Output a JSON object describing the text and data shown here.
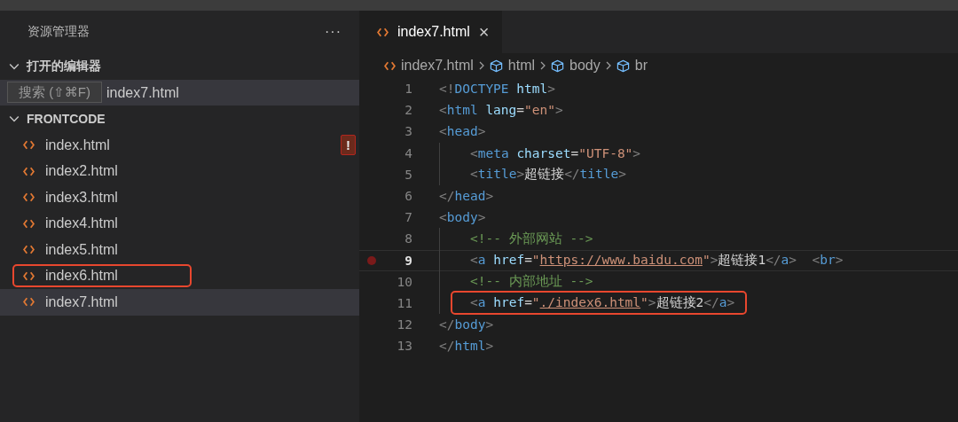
{
  "sidebar": {
    "title": "资源管理器",
    "more": "···",
    "open_editors": {
      "label": "打开的编辑器",
      "expanded": true,
      "items": [
        {
          "name": "index7.html"
        }
      ]
    },
    "tooltip": "搜索 (⇧⌘F)",
    "folder": {
      "label": "FRONTCODE",
      "expanded": true,
      "files": [
        {
          "name": "index.html",
          "selected": false,
          "highlighted": false,
          "badge": "!"
        },
        {
          "name": "index2.html",
          "selected": false,
          "highlighted": false
        },
        {
          "name": "index3.html",
          "selected": false,
          "highlighted": false
        },
        {
          "name": "index4.html",
          "selected": false,
          "highlighted": false
        },
        {
          "name": "index5.html",
          "selected": false,
          "highlighted": false
        },
        {
          "name": "index6.html",
          "selected": false,
          "highlighted": true
        },
        {
          "name": "index7.html",
          "selected": true,
          "highlighted": false
        }
      ]
    }
  },
  "tabs": [
    {
      "label": "index7.html",
      "selected": true,
      "close": "×"
    }
  ],
  "breadcrumb": [
    {
      "label": "index7.html",
      "kind": "file"
    },
    {
      "label": "html",
      "kind": "element"
    },
    {
      "label": "body",
      "kind": "element"
    },
    {
      "label": "br",
      "kind": "element"
    }
  ],
  "code": [
    {
      "number": "1",
      "tokens": [
        {
          "t": "<!",
          "kind": "punct"
        },
        {
          "t": "DOCTYPE",
          "kind": "tag"
        },
        {
          "t": " html",
          "kind": "attr"
        },
        {
          "t": ">",
          "kind": "punct"
        }
      ]
    },
    {
      "number": "2",
      "tokens": [
        {
          "t": "<",
          "kind": "punct"
        },
        {
          "t": "html",
          "kind": "tag"
        },
        {
          "t": " lang",
          "kind": "attr"
        },
        {
          "t": "=",
          "kind": "text"
        },
        {
          "t": "\"en\"",
          "kind": "str"
        },
        {
          "t": ">",
          "kind": "punct"
        }
      ]
    },
    {
      "number": "3",
      "tokens": [
        {
          "t": "<",
          "kind": "punct"
        },
        {
          "t": "head",
          "kind": "tag"
        },
        {
          "t": ">",
          "kind": "punct"
        }
      ],
      "children": [
        {
          "number": "4",
          "tokens": [
            {
              "t": "<",
              "kind": "punct"
            },
            {
              "t": "meta",
              "kind": "tag"
            },
            {
              "t": " charset",
              "kind": "attr"
            },
            {
              "t": "=",
              "kind": "text"
            },
            {
              "t": "\"UTF-8\"",
              "kind": "str"
            },
            {
              "t": ">",
              "kind": "punct"
            }
          ]
        },
        {
          "number": "5",
          "tokens": [
            {
              "t": "<",
              "kind": "punct"
            },
            {
              "t": "title",
              "kind": "tag"
            },
            {
              "t": ">",
              "kind": "punct"
            },
            {
              "t": "超链接",
              "kind": "text"
            },
            {
              "t": "</",
              "kind": "punct"
            },
            {
              "t": "title",
              "kind": "tag"
            },
            {
              "t": ">",
              "kind": "punct"
            }
          ]
        }
      ]
    },
    {
      "number": "6",
      "tokens": [
        {
          "t": "</",
          "kind": "punct"
        },
        {
          "t": "head",
          "kind": "tag"
        },
        {
          "t": ">",
          "kind": "punct"
        }
      ]
    },
    {
      "number": "7",
      "tokens": [
        {
          "t": "<",
          "kind": "punct"
        },
        {
          "t": "body",
          "kind": "tag"
        },
        {
          "t": ">",
          "kind": "punct"
        }
      ],
      "children": [
        {
          "number": "8",
          "tokens": [
            {
              "t": "<!-- 外部网站 -->",
              "kind": "comment"
            }
          ]
        },
        {
          "number": "9",
          "breakpoint": true,
          "current": true,
          "tokens": [
            {
              "t": "<",
              "kind": "punct"
            },
            {
              "t": "a",
              "kind": "tag"
            },
            {
              "t": " href",
              "kind": "attr"
            },
            {
              "t": "=",
              "kind": "text"
            },
            {
              "t": "\"",
              "kind": "str"
            },
            {
              "t": "https://www.baidu.com",
              "kind": "link"
            },
            {
              "t": "\"",
              "kind": "str"
            },
            {
              "t": ">",
              "kind": "punct"
            },
            {
              "t": "超链接1",
              "kind": "text"
            },
            {
              "t": "</",
              "kind": "punct"
            },
            {
              "t": "a",
              "kind": "tag"
            },
            {
              "t": ">",
              "kind": "punct"
            },
            {
              "t": "  <",
              "kind": "punct"
            },
            {
              "t": "br",
              "kind": "tag"
            },
            {
              "t": ">",
              "kind": "punct"
            }
          ]
        },
        {
          "number": "10",
          "tokens": [
            {
              "t": "<!-- 内部地址 -->",
              "kind": "comment"
            }
          ]
        },
        {
          "number": "11",
          "highlighted": true,
          "tokens": [
            {
              "t": "<",
              "kind": "punct"
            },
            {
              "t": "a",
              "kind": "tag"
            },
            {
              "t": " href",
              "kind": "attr"
            },
            {
              "t": "=",
              "kind": "text"
            },
            {
              "t": "\"",
              "kind": "str"
            },
            {
              "t": "./index6.html",
              "kind": "link"
            },
            {
              "t": "\"",
              "kind": "str"
            },
            {
              "t": ">",
              "kind": "punct"
            },
            {
              "t": "超链接2",
              "kind": "text"
            },
            {
              "t": "</",
              "kind": "punct"
            },
            {
              "t": "a",
              "kind": "tag"
            },
            {
              "t": ">",
              "kind": "punct"
            }
          ]
        }
      ]
    },
    {
      "number": "12",
      "tokens": [
        {
          "t": "</",
          "kind": "punct"
        },
        {
          "t": "body",
          "kind": "tag"
        },
        {
          "t": ">",
          "kind": "punct"
        }
      ]
    },
    {
      "number": "13",
      "tokens": [
        {
          "t": "</",
          "kind": "punct"
        },
        {
          "t": "html",
          "kind": "tag"
        },
        {
          "t": ">",
          "kind": "punct"
        }
      ]
    }
  ]
}
